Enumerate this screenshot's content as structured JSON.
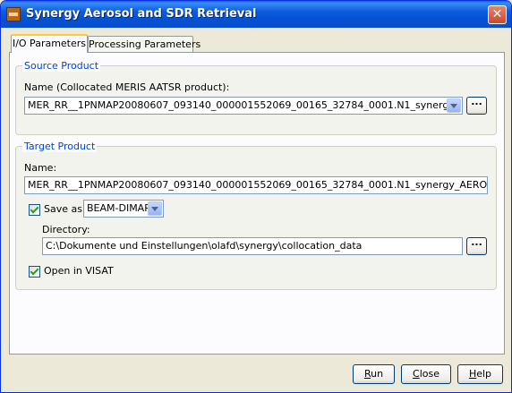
{
  "window": {
    "title": "Synergy Aerosol and SDR Retrieval",
    "app_icon": "beam-app-icon",
    "close_glyph": "✕"
  },
  "tabs": [
    {
      "label": "I/O Parameters",
      "active": true
    },
    {
      "label": "Processing Parameters",
      "active": false
    }
  ],
  "source_product": {
    "group_title": "Source Product",
    "name_label": "Name (Collocated MERIS AATSR product):",
    "selected_value": "MER_RR__1PNMAP20080607_093140_000001552069_00165_32784_0001.N1_synergy",
    "browse_label": "..."
  },
  "target_product": {
    "group_title": "Target Product",
    "name_label": "Name:",
    "name_value": "MER_RR__1PNMAP20080607_093140_000001552069_00165_32784_0001.N1_synergy_AERO",
    "save_as_label": "Save as:",
    "save_as_checked": true,
    "format_value": "BEAM-DIMAP",
    "directory_label": "Directory:",
    "directory_value": "C:\\Dokumente und Einstellungen\\olafd\\synergy\\collocation_data",
    "browse_label": "...",
    "open_in_visat_label": "Open in VISAT",
    "open_in_visat_checked": true
  },
  "buttons": {
    "run": {
      "mnemonic": "R",
      "rest": "un"
    },
    "close": {
      "mnemonic": "C",
      "rest": "lose"
    },
    "help": {
      "mnemonic": "H",
      "rest": "elp"
    }
  },
  "colors": {
    "titlebar": "#0A5FE8",
    "group_title": "#0046D5",
    "window_bg": "#ECE9D8",
    "check_mark": "#21A121"
  }
}
